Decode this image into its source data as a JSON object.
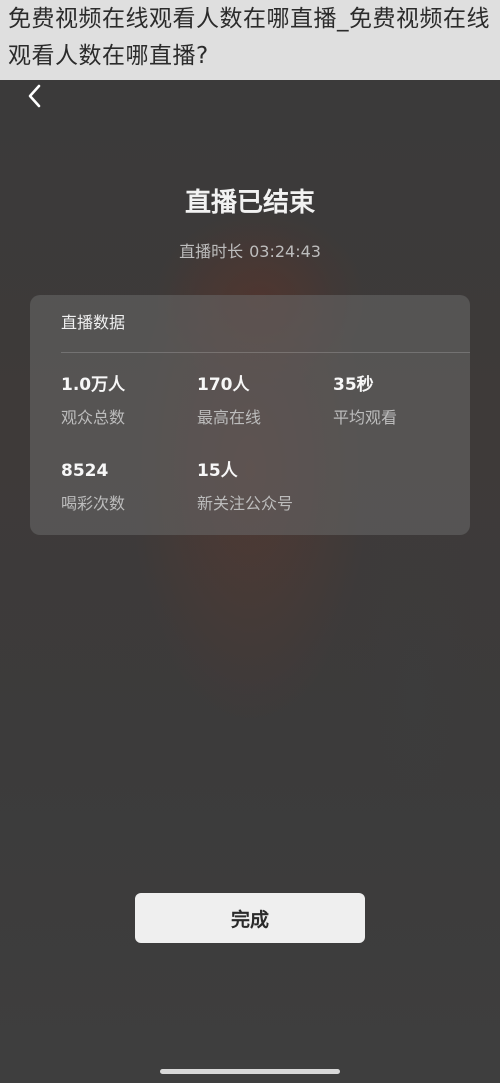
{
  "overlay": {
    "title": "免费视频在线观看人数在哪直播_免费视频在线观看人数在哪直播?"
  },
  "icons": {
    "back": "chevron-left-icon"
  },
  "live": {
    "heading": "直播已结束",
    "duration_label": "直播时长",
    "duration_value": "03:24:43"
  },
  "stats_card": {
    "title": "直播数据",
    "items": [
      {
        "value": "1.0万人",
        "label": "观众总数"
      },
      {
        "value": "170人",
        "label": "最高在线"
      },
      {
        "value": "35秒",
        "label": "平均观看"
      },
      {
        "value": "8524",
        "label": "喝彩次数"
      },
      {
        "value": "15人",
        "label": "新关注公众号"
      }
    ]
  },
  "actions": {
    "done_label": "完成"
  },
  "colors": {
    "background": "#3d3d3d",
    "card": "#5f5f5f",
    "button": "#efefef"
  }
}
